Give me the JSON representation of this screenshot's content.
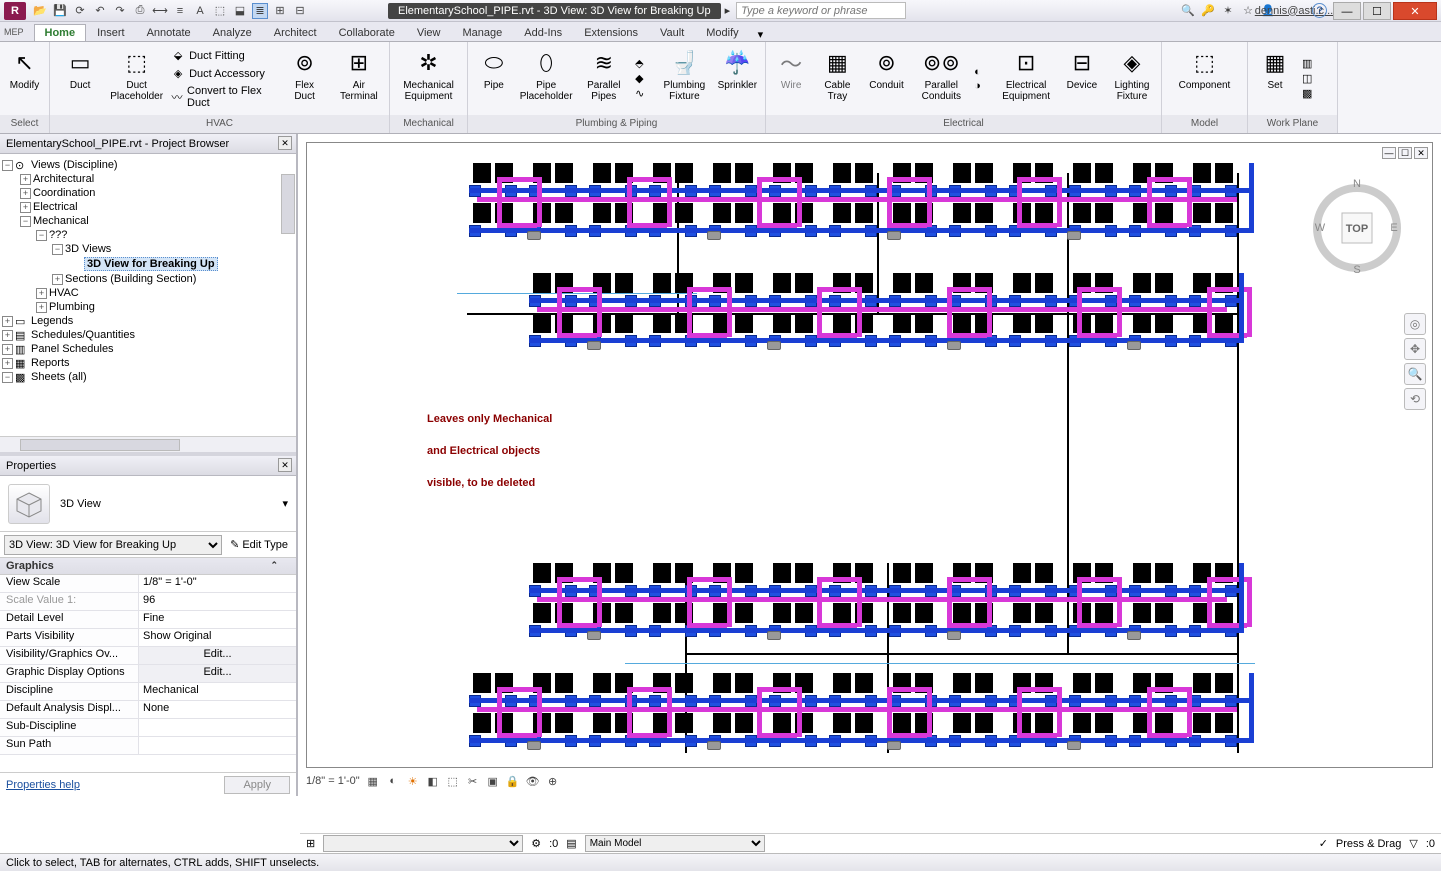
{
  "titlebar": {
    "logo": "R",
    "mep_label": "MEP",
    "doc_title": "ElementarySchool_PIPE.rvt - 3D View: 3D View for Breaking Up",
    "search_placeholder": "Type a keyword or phrase",
    "user": "dennis@asti.c...",
    "help_icon": "?"
  },
  "tabs": [
    "Home",
    "Insert",
    "Annotate",
    "Analyze",
    "Architect",
    "Collaborate",
    "View",
    "Manage",
    "Add-Ins",
    "Extensions",
    "Vault",
    "Modify"
  ],
  "active_tab": "Home",
  "ribbon": {
    "select": {
      "modify": "Modify",
      "label": "Select"
    },
    "hvac": {
      "duct": "Duct",
      "placeholder": "Duct\nPlaceholder",
      "small": [
        "Duct Fitting",
        "Duct Accessory",
        "Convert to Flex Duct"
      ],
      "flexduct": "Flex\nDuct",
      "airterm": "Air\nTerminal",
      "mecheq": "Mechanical\nEquipment",
      "label": "HVAC",
      "label2": "Mechanical"
    },
    "plumb": {
      "pipe": "Pipe",
      "pipeph": "Pipe\nPlaceholder",
      "parpipe": "Parallel\nPipes",
      "plfix": "Plumbing\nFixture",
      "spr": "Sprinkler",
      "label": "Plumbing & Piping"
    },
    "elec": {
      "wire": "Wire",
      "cable": "Cable\nTray",
      "conduit": "Conduit",
      "parcond": "Parallel\nConduits",
      "eleq": "Electrical\nEquipment",
      "device": "Device",
      "light": "Lighting\nFixture",
      "comp": "Component",
      "label": "Electrical"
    },
    "model": {
      "btn": "Set",
      "label": "Model",
      "label2": "Work Plane"
    }
  },
  "browser": {
    "title": "ElementarySchool_PIPE.rvt - Project Browser",
    "root": "Views (Discipline)",
    "items": [
      "Architectural",
      "Coordination",
      "Electrical",
      "Mechanical",
      "???",
      "3D Views",
      "3D View for Breaking Up",
      "Sections (Building Section)",
      "HVAC",
      "Plumbing",
      "Legends",
      "Schedules/Quantities",
      "Panel Schedules",
      "Reports",
      "Sheets (all)"
    ]
  },
  "properties": {
    "title": "Properties",
    "type": "3D View",
    "selector": "3D View: 3D View for Breaking Up",
    "edit_type": "Edit Type",
    "group": "Graphics",
    "rows": [
      {
        "k": "View Scale",
        "v": "1/8\" = 1'-0\""
      },
      {
        "k": "Scale Value   1:",
        "v": "96",
        "dis": true
      },
      {
        "k": "Detail Level",
        "v": "Fine"
      },
      {
        "k": "Parts Visibility",
        "v": "Show Original"
      },
      {
        "k": "Visibility/Graphics Ov...",
        "v": "Edit...",
        "btn": true
      },
      {
        "k": "Graphic Display Options",
        "v": "Edit...",
        "btn": true
      },
      {
        "k": "Discipline",
        "v": "Mechanical"
      },
      {
        "k": "Default Analysis Displ...",
        "v": "None"
      },
      {
        "k": "Sub-Discipline",
        "v": ""
      },
      {
        "k": "Sun Path",
        "v": ""
      }
    ],
    "help": "Properties help",
    "apply": "Apply"
  },
  "annotation": {
    "l1": "Leaves only Mechanical",
    "l2": "and Electrical objects",
    "l3": "visible, to be deleted"
  },
  "viewbar": {
    "scale": "1/8\" = 1'-0\""
  },
  "viewcube": {
    "face": "TOP"
  },
  "status2": {
    "zero": ":0",
    "mainmodel": "Main Model",
    "press": "Press & Drag",
    "filter": ":0"
  },
  "status": {
    "msg": "Click to select, TAB for alternates, CTRL adds, SHIFT unselects."
  }
}
